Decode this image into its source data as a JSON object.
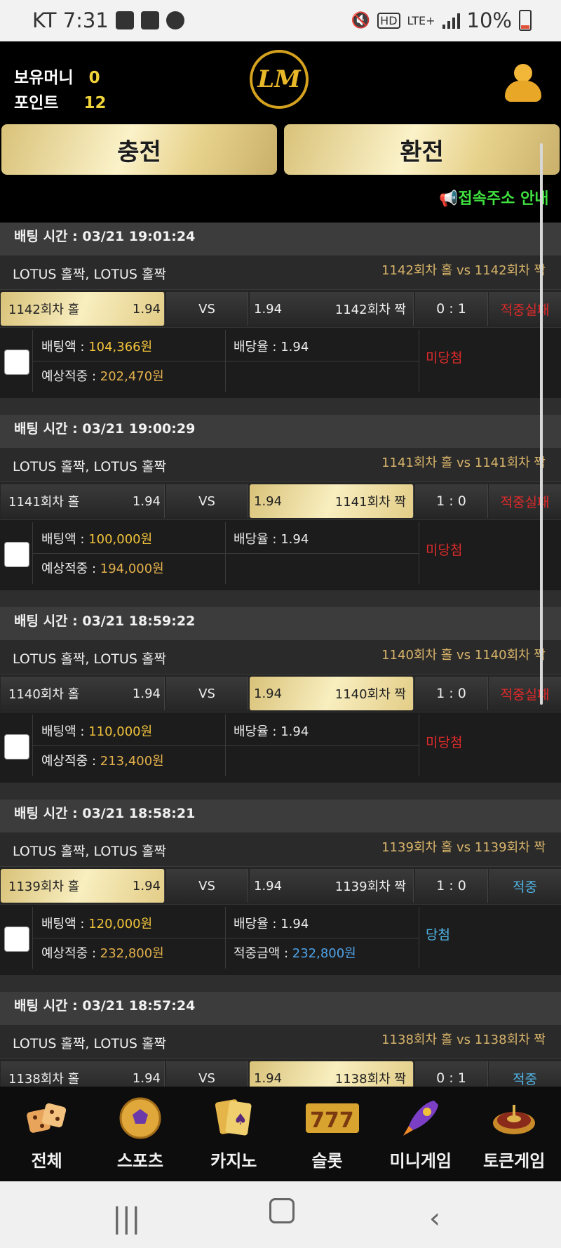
{
  "status_bar": {
    "carrier_time": "KT 7:31",
    "network": "LTE+",
    "battery": "10%"
  },
  "header": {
    "money_label": "보유머니",
    "money_value": "0",
    "points_label": "포인트",
    "points_value": "12",
    "logo_text": "LM"
  },
  "actions": {
    "charge": "충전",
    "exchange": "환전"
  },
  "ticker": {
    "text": "📢접속주소 안내"
  },
  "bets": [
    {
      "time": "배팅 시간 : 03/21 19:01:24",
      "game": "LOTUS 홀짝, LOTUS 홀짝",
      "match": "1142회차 홀  vs  1142회차 짝",
      "home": "1142회차 홀",
      "home_odds": "1.94",
      "vs": "VS",
      "away_odds": "1.94",
      "away": "1142회차 짝",
      "selected": "home",
      "score": "0 : 1",
      "result": "적중실패",
      "bet_label": "배팅액 : ",
      "bet_amount": "104,366원",
      "expected_label": "예상적중 : ",
      "expected": "202,470원",
      "odds_label": "배당율 : ",
      "odds": "1.94",
      "win_label": "",
      "win_amount": "",
      "status": "미당첨"
    },
    {
      "time": "배팅 시간 : 03/21 19:00:29",
      "game": "LOTUS 홀짝, LOTUS 홀짝",
      "match": "1141회차 홀  vs  1141회차 짝",
      "home": "1141회차 홀",
      "home_odds": "1.94",
      "vs": "VS",
      "away_odds": "1.94",
      "away": "1141회차 짝",
      "selected": "away",
      "score": "1 : 0",
      "result": "적중실패",
      "bet_label": "배팅액 : ",
      "bet_amount": "100,000원",
      "expected_label": "예상적중 : ",
      "expected": "194,000원",
      "odds_label": "배당율 : ",
      "odds": "1.94",
      "win_label": "",
      "win_amount": "",
      "status": "미당첨"
    },
    {
      "time": "배팅 시간 : 03/21 18:59:22",
      "game": "LOTUS 홀짝, LOTUS 홀짝",
      "match": "1140회차 홀  vs  1140회차 짝",
      "home": "1140회차 홀",
      "home_odds": "1.94",
      "vs": "VS",
      "away_odds": "1.94",
      "away": "1140회차 짝",
      "selected": "away",
      "score": "1 : 0",
      "result": "적중실패",
      "bet_label": "배팅액 : ",
      "bet_amount": "110,000원",
      "expected_label": "예상적중 : ",
      "expected": "213,400원",
      "odds_label": "배당율 : ",
      "odds": "1.94",
      "win_label": "",
      "win_amount": "",
      "status": "미당첨"
    },
    {
      "time": "배팅 시간 : 03/21 18:58:21",
      "game": "LOTUS 홀짝, LOTUS 홀짝",
      "match": "1139회차 홀  vs  1139회차 짝",
      "home": "1139회차 홀",
      "home_odds": "1.94",
      "vs": "VS",
      "away_odds": "1.94",
      "away": "1139회차 짝",
      "selected": "home",
      "score": "1 : 0",
      "result": "적중",
      "bet_label": "배팅액 : ",
      "bet_amount": "120,000원",
      "expected_label": "예상적중 : ",
      "expected": "232,800원",
      "odds_label": "배당율 : ",
      "odds": "1.94",
      "win_label": "적중금액 : ",
      "win_amount": "232,800원",
      "status": "당첨"
    },
    {
      "time": "배팅 시간 : 03/21 18:57:24",
      "game": "LOTUS 홀짝, LOTUS 홀짝",
      "match": "1138회차 홀  vs  1138회차 짝",
      "home": "1138회차 홀",
      "home_odds": "1.94",
      "vs": "VS",
      "away_odds": "1.94",
      "away": "1138회차 짝",
      "selected": "away",
      "score": "0 : 1",
      "result": "적중",
      "bet_label": "",
      "bet_amount": "",
      "expected_label": "",
      "expected": "",
      "odds_label": "",
      "odds": "",
      "win_label": "",
      "win_amount": "",
      "status": ""
    }
  ],
  "bottom_nav": [
    {
      "label": "전체",
      "icon": "dice-icon"
    },
    {
      "label": "스포츠",
      "icon": "soccer-ball-icon"
    },
    {
      "label": "카지노",
      "icon": "cards-icon"
    },
    {
      "label": "슬롯",
      "icon": "slot-777-icon"
    },
    {
      "label": "미니게임",
      "icon": "rocket-icon"
    },
    {
      "label": "토큰게임",
      "icon": "roulette-icon"
    }
  ],
  "colors": {
    "gold": "#e3b04b",
    "fail": "#e02a2a",
    "win": "#4fb3e3",
    "ticker": "#3fe03f"
  }
}
